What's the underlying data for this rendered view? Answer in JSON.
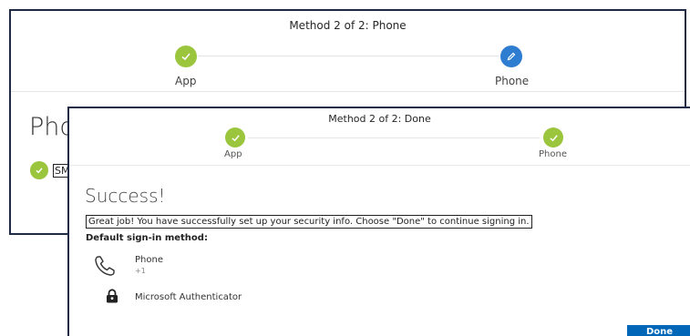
{
  "back_window": {
    "title": "Method 2 of 2: Phone",
    "steps": [
      {
        "label": "App",
        "state": "complete",
        "icon": "check-icon",
        "color": "#9bc53d"
      },
      {
        "label": "Phone",
        "state": "current",
        "icon": "pencil-icon",
        "color": "#2f7dd1"
      }
    ],
    "heading": "Pho",
    "sms_text": "SM"
  },
  "front_window": {
    "title": "Method 2 of 2: Done",
    "steps": [
      {
        "label": "App",
        "state": "complete",
        "icon": "check-icon",
        "color": "#9bc53d"
      },
      {
        "label": "Phone",
        "state": "complete",
        "icon": "check-icon",
        "color": "#9bc53d"
      }
    ],
    "heading": "Success!",
    "message": "Great job! You have successfully set up your security info. Choose \"Done\" to continue signing in.",
    "default_label": "Default sign-in method:",
    "methods": [
      {
        "name": "Phone",
        "detail": "+1",
        "icon": "phone-icon"
      },
      {
        "name": "Microsoft Authenticator",
        "icon": "lock-icon"
      }
    ],
    "done_label": "Done",
    "accent_color": "#0067b8"
  }
}
